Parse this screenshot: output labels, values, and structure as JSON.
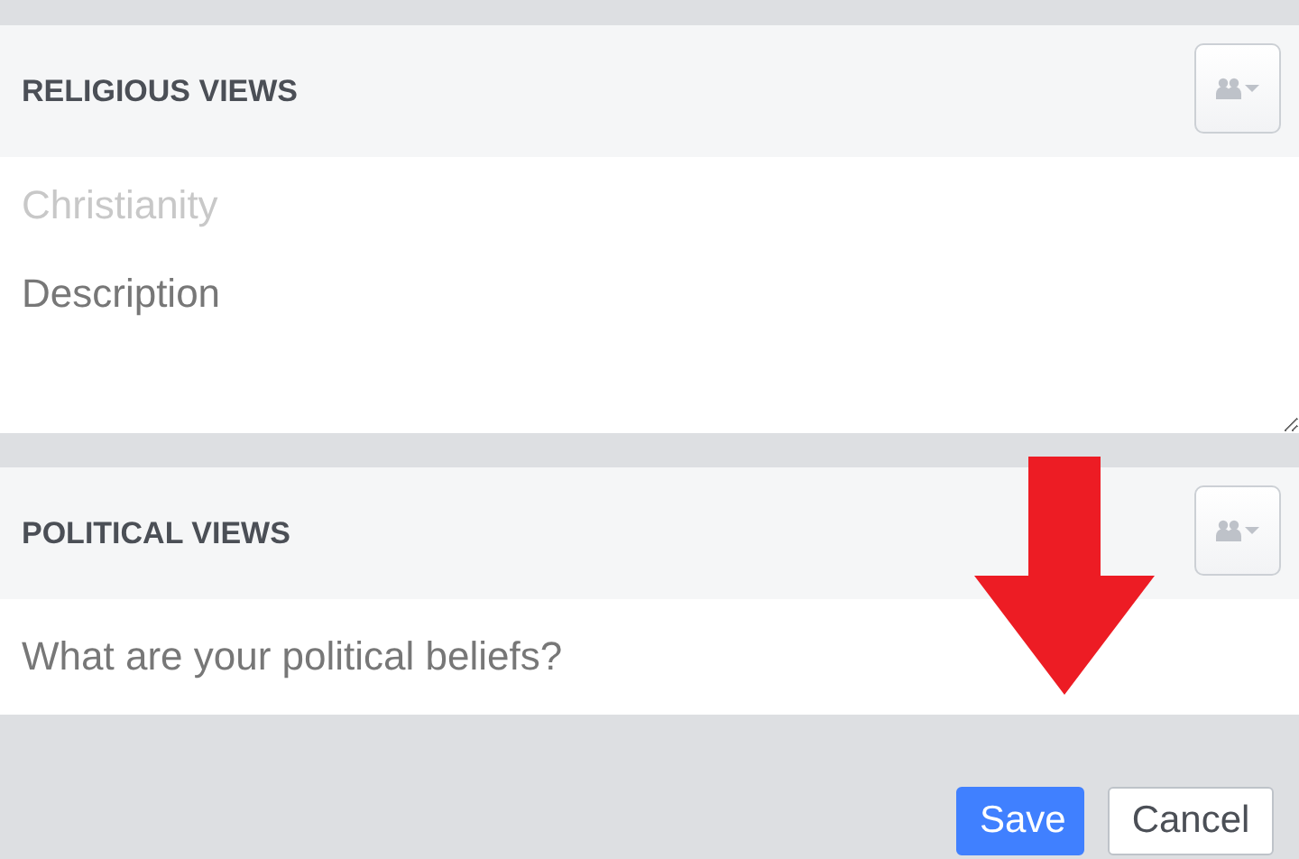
{
  "sections": [
    {
      "title": "RELIGIOUS VIEWS",
      "fields": [
        {
          "kind": "value",
          "value": "Christianity"
        },
        {
          "kind": "textarea",
          "placeholder": "Description"
        }
      ]
    },
    {
      "title": "POLITICAL VIEWS",
      "fields": [
        {
          "kind": "input",
          "placeholder": "What are your political beliefs?"
        }
      ]
    }
  ],
  "buttons": [
    {
      "label": "Save",
      "kind": "primary"
    },
    {
      "label": "Cancel",
      "kind": "secondary"
    }
  ]
}
